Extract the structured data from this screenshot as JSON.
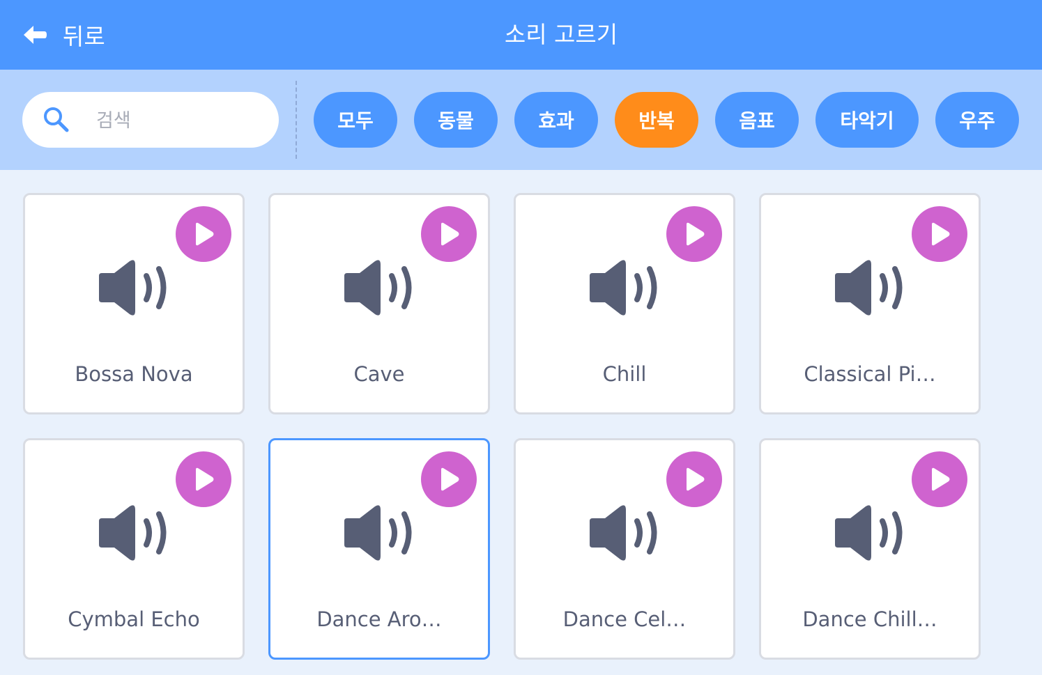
{
  "header": {
    "back_label": "뒤로",
    "title": "소리 고르기",
    "background": "#4c97ff"
  },
  "search": {
    "placeholder": "검색",
    "value": "",
    "icon": "search-icon"
  },
  "tags": [
    {
      "label": "모두",
      "active": false
    },
    {
      "label": "동물",
      "active": false
    },
    {
      "label": "효과",
      "active": false
    },
    {
      "label": "반복",
      "active": true
    },
    {
      "label": "음표",
      "active": false
    },
    {
      "label": "타악기",
      "active": false
    },
    {
      "label": "우주",
      "active": false
    }
  ],
  "colors": {
    "accent": "#4c97ff",
    "active_tag": "#ff8c1a",
    "play_button": "#cf63cf",
    "icon": "#575e75"
  },
  "sounds": [
    {
      "name": "Bossa Nova",
      "selected": false,
      "icon": "speaker-icon"
    },
    {
      "name": "Cave",
      "selected": false,
      "icon": "speaker-icon"
    },
    {
      "name": "Chill",
      "selected": false,
      "icon": "speaker-icon"
    },
    {
      "name": "Classical Pi…",
      "selected": false,
      "icon": "speaker-icon"
    },
    {
      "name": "Cymbal Echo",
      "selected": false,
      "icon": "speaker-icon"
    },
    {
      "name": "Dance Aro…",
      "selected": true,
      "icon": "speaker-icon"
    },
    {
      "name": "Dance Cel…",
      "selected": false,
      "icon": "speaker-icon"
    },
    {
      "name": "Dance Chill…",
      "selected": false,
      "icon": "speaker-icon"
    }
  ]
}
